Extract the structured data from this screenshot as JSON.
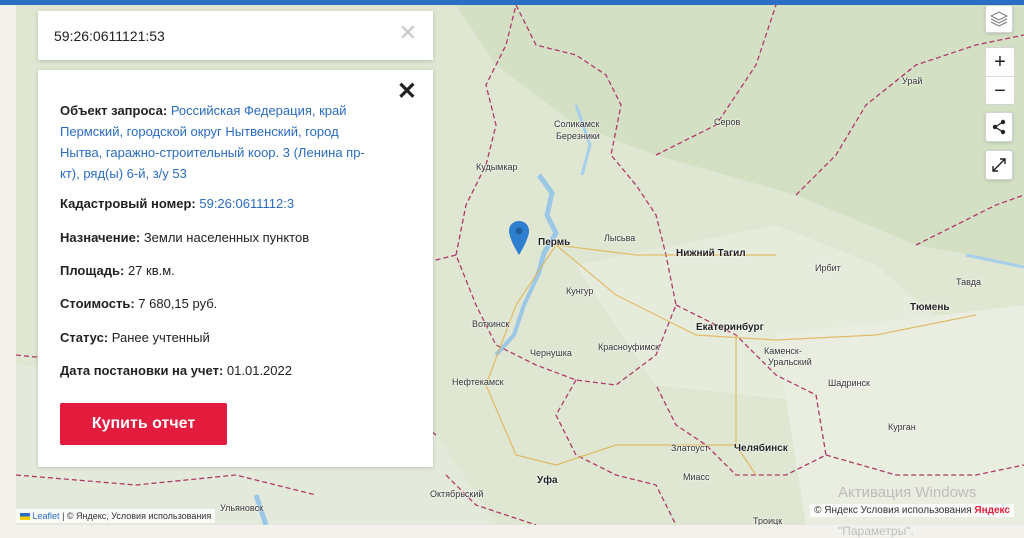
{
  "search": {
    "value": "59:26:0611121:53",
    "clear_icon": "close-icon"
  },
  "info": {
    "object_label": "Объект запроса:",
    "object_line1": "Российская Федерация, край",
    "object_line2": "Пермский, городской округ Нытвенский, город",
    "object_line3": "Нытва, гаражно-строительный коop. 3 (Ленина пр-",
    "object_line4": "кт), ряд(ы) 6-й, з/у 53",
    "cadastral_label": "Кадастровый номер:",
    "cadastral_value": "59:26:0611112:3",
    "purpose_label": "Назначение:",
    "purpose_value": "Земли населенных пунктов",
    "area_label": "Площадь:",
    "area_value": "27 кв.м.",
    "cost_label": "Стоимость:",
    "cost_value": "7 680,15 руб.",
    "status_label": "Статус:",
    "status_value": "Ранее учтенный",
    "date_label": "Дата постановки на учет:",
    "date_value": "01.01.2022",
    "buy_label": "Купить отчет"
  },
  "controls": {
    "zoom_in": "+",
    "zoom_out": "−"
  },
  "cities": {
    "solikamsk": "Соликамск",
    "berezniki": "Березники",
    "kudymkar": "Кудымкар",
    "perm": "Пермь",
    "lysva": "Лысьва",
    "kungur": "Кунгур",
    "votkinsk": "Воткинск",
    "chernushka": "Чернушка",
    "krasnoufimsk": "Красноуфимск",
    "neftekamsk": "Нефтекамск",
    "ufa": "Уфа",
    "oktyabrsky": "Октябрьский",
    "ulyanovsk": "Ульяновск",
    "zlatoust": "Златоуст",
    "chelyabinsk": "Челябинск",
    "miass": "Миасс",
    "troitsk": "Троицк",
    "nizhny_tagil": "Нижний Тагил",
    "ekaterinburg": "Екатеринбург",
    "kamensk": "Каменск-",
    "uralsky": "Уральский",
    "irbit": "Ирбит",
    "tyumen": "Тюмень",
    "shadrinsk": "Шадринск",
    "kurgan": "Курган",
    "serov": "Серов",
    "uray": "Урай",
    "tavda": "Тавда"
  },
  "attribution": {
    "leaflet": "Leaflet",
    "left_text": "| © Яндекс, Условия использования",
    "right_text": "© Яндекс Условия использования",
    "brand": "Яндекс"
  },
  "watermark": {
    "line1": "Активация Windows",
    "line2": "\"Параметры\"."
  }
}
